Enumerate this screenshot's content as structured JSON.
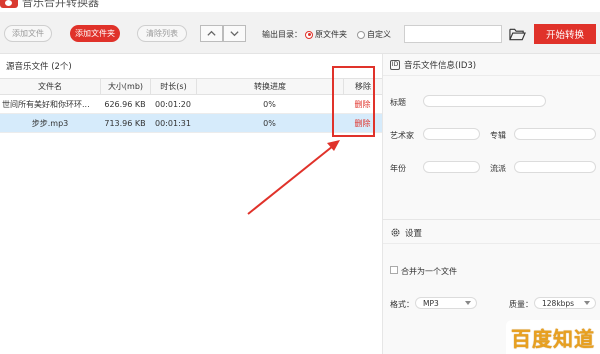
{
  "window": {
    "title": "音乐合并转换器"
  },
  "toolbar": {
    "add_file": "添加文件",
    "add_folder": "添加文件夹",
    "clear_list": "清除列表",
    "output_label": "输出目录：",
    "radio_source": "原文件夹",
    "radio_custom": "自定义",
    "path_value": "",
    "start": "开始转换"
  },
  "source": {
    "title": "源音乐文件 (2个)",
    "columns": [
      "文件名",
      "大小(mb)",
      "时长(s)",
      "转换进度",
      "移除"
    ],
    "rows": [
      {
        "name": "世间所有美好和你环环...",
        "size": "626.96 KB",
        "duration": "00:01:20",
        "progress": "0%",
        "remove": "删除",
        "selected": false
      },
      {
        "name": "步步.mp3",
        "size": "713.96 KB",
        "duration": "00:01:31",
        "progress": "0%",
        "remove": "删除",
        "selected": true
      }
    ]
  },
  "id3": {
    "title": "音乐文件信息(ID3)",
    "badge": "ID",
    "title_label": "标题",
    "artist_label": "艺术家",
    "album_label": "专辑",
    "year_label": "年份",
    "genre_label": "流派"
  },
  "settings": {
    "title": "设置",
    "merge_label": "合并为一个文件",
    "format_label": "格式：",
    "format_value": "MP3",
    "quality_label": "质量：",
    "quality_value": "128kbps"
  },
  "watermark": {
    "text": "百度知道"
  },
  "colors": {
    "accent": "#e0322a",
    "selected_row": "#d6ebfb",
    "watermark": "#e8a020"
  }
}
